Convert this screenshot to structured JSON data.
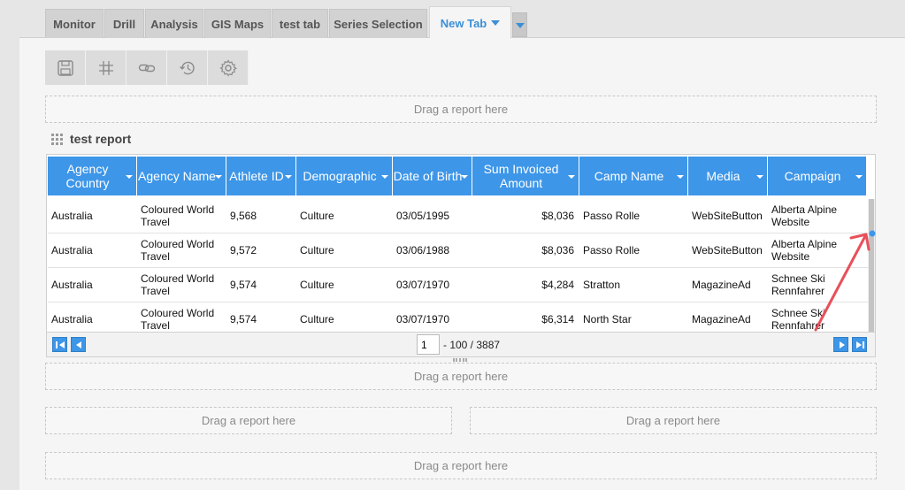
{
  "tabs": [
    {
      "label": "Monitor"
    },
    {
      "label": "Drill"
    },
    {
      "label": "Analysis"
    },
    {
      "label": "GIS Maps"
    },
    {
      "label": "test tab"
    },
    {
      "label": "Series Selection"
    },
    {
      "label": "New Tab"
    }
  ],
  "toolbar": [
    {
      "icon": "save-icon"
    },
    {
      "icon": "grid-icon"
    },
    {
      "icon": "link-icon"
    },
    {
      "icon": "history-icon"
    },
    {
      "icon": "gear-icon"
    }
  ],
  "dropzones": {
    "label": "Drag a report here"
  },
  "report": {
    "title": "test report",
    "columns": [
      "Agency Country",
      "Agency Name",
      "Athlete ID",
      "Demographic",
      "Date of Birth",
      "Sum Invoiced Amount",
      "Camp Name",
      "Media",
      "Campaign"
    ],
    "rows": [
      [
        "Australia",
        "Coloured World Travel",
        "9,568",
        "Culture",
        "03/05/1995",
        "$8,036",
        "Passo Rolle",
        "WebSiteButton",
        "Alberta Alpine Website"
      ],
      [
        "Australia",
        "Coloured World Travel",
        "9,572",
        "Culture",
        "03/06/1988",
        "$8,036",
        "Passo Rolle",
        "WebSiteButton",
        "Alberta Alpine Website"
      ],
      [
        "Australia",
        "Coloured World Travel",
        "9,574",
        "Culture",
        "03/07/1970",
        "$4,284",
        "Stratton",
        "MagazineAd",
        "Schnee Ski Rennfahrer"
      ],
      [
        "Australia",
        "Coloured World Travel",
        "9,574",
        "Culture",
        "03/07/1970",
        "$6,314",
        "North Star",
        "MagazineAd",
        "Schnee Ski Rennfahrer"
      ]
    ]
  },
  "pager": {
    "page": "1",
    "range": "- 100 / 3887"
  },
  "colors": {
    "header_blue": "#3d96e8",
    "active_tab_text": "#3c8fd6",
    "annotation_arrow": "#e8505b"
  }
}
